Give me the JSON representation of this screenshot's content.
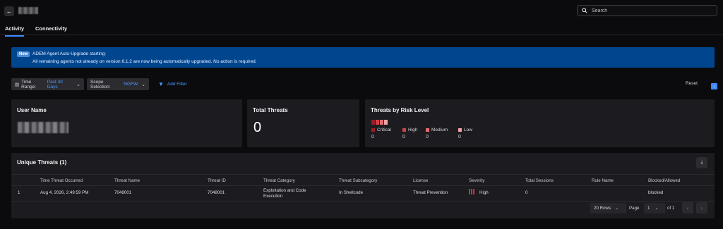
{
  "header": {
    "back_icon": "arrow-left-icon",
    "search_placeholder": "Search"
  },
  "tabs": [
    {
      "label": "Activity",
      "active": true
    },
    {
      "label": "Connectivity",
      "active": false
    }
  ],
  "banner": {
    "badge": "New",
    "title": "ADEM Agent Auto-Upgrade starting:",
    "text": "All remaining agents not already on version 6.1.2 are now being automatically upgraded. No action is required.",
    "color": "#00468f"
  },
  "filters": {
    "time_range_label": "Time Range:",
    "time_range_value": "Past 30 Days",
    "scope_label": "Scope Selection:",
    "scope_value": "NGFW",
    "add_filter": "Add Filter",
    "reset": "Reset"
  },
  "cards": {
    "user": {
      "title": "User Name"
    },
    "total": {
      "title": "Total Threats",
      "value": "0"
    },
    "risk": {
      "title": "Threats by Risk Level",
      "levels": [
        {
          "label": "Critical",
          "count": "0",
          "color": "#9b1c26"
        },
        {
          "label": "High",
          "count": "0",
          "color": "#d2404b"
        },
        {
          "label": "Medium",
          "count": "0",
          "color": "#e86a6f"
        },
        {
          "label": "Low",
          "count": "0",
          "color": "#f2a3a3"
        }
      ]
    }
  },
  "threats": {
    "title": "Unique Threats (1)",
    "columns": [
      "Time Threat Occurred",
      "Threat Name",
      "Threat ID",
      "Threat Category",
      "Threat Subcategory",
      "License",
      "Severity",
      "Total Sessions",
      "Rule Name",
      "Blocked/Allowed"
    ],
    "rows": [
      {
        "index": "1",
        "time": "Aug 4, 2026, 2:49:59 PM",
        "name": "7048001",
        "id": "7048001",
        "category_line1": "Exploitation and Code",
        "category_line2": "Execution",
        "subcategory": "In Shellcode",
        "license": "Threat Prevention",
        "severity": "High",
        "sessions": "0",
        "rule": "",
        "action": "blocked"
      }
    ],
    "pager": {
      "rows_label": "20 Rows",
      "page_label": "Page",
      "page_value": "1",
      "of_label": "of 1"
    }
  }
}
